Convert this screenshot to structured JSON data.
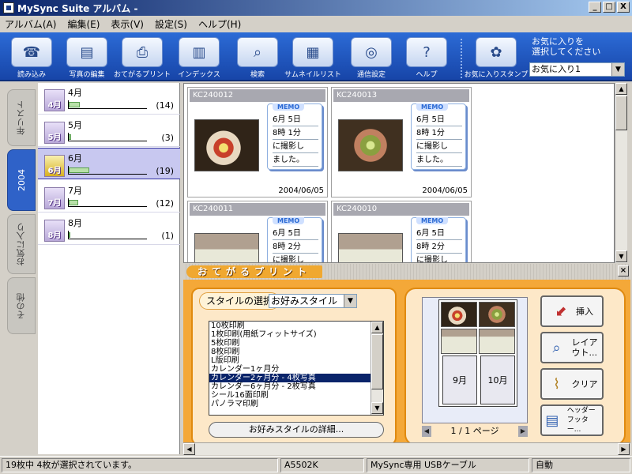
{
  "window": {
    "title": "MySync Suite アルバム -",
    "minimize": "_",
    "maximize": "□",
    "close": "X"
  },
  "menu": [
    "アルバム(A)",
    "編集(E)",
    "表示(V)",
    "設定(S)",
    "ヘルプ(H)"
  ],
  "toolbar": {
    "buttons": [
      {
        "label": "読み込み",
        "icon": "phone-icon"
      },
      {
        "label": "写真の編集",
        "icon": "photo-stack-icon"
      },
      {
        "label": "おてがるプリント",
        "icon": "print-icon"
      },
      {
        "label": "インデックス",
        "icon": "index-icon"
      },
      {
        "label": "検索",
        "icon": "search-icon"
      },
      {
        "label": "サムネイルリスト",
        "icon": "thumbnail-list-icon"
      },
      {
        "label": "通信設定",
        "icon": "headset-icon"
      },
      {
        "label": "ヘルプ",
        "icon": "help-icon"
      },
      {
        "label": "お気に入りスタンプ",
        "icon": "stamp-icon"
      }
    ],
    "favorite_caption_1": "お気に入りを",
    "favorite_caption_2": "選択してください",
    "favorite_value": "お気に入り1"
  },
  "left_tabs": [
    "年リスト",
    "2004",
    "お気に入り",
    "その他"
  ],
  "months": [
    {
      "label": "4月",
      "icon": "4月",
      "count": "(14)",
      "fill": 0.14
    },
    {
      "label": "5月",
      "icon": "5月",
      "count": "(3)",
      "fill": 0.03
    },
    {
      "label": "6月",
      "icon": "6月",
      "count": "(19)",
      "fill": 0.26
    },
    {
      "label": "7月",
      "icon": "7月",
      "count": "(12)",
      "fill": 0.12
    },
    {
      "label": "8月",
      "icon": "8月",
      "count": "(1)",
      "fill": 0.01
    }
  ],
  "photos": [
    {
      "id": "KC240012",
      "memo_tag": "MEMO",
      "memo": [
        "6月 5日",
        "8時 1分",
        "に撮影し",
        "ました。"
      ],
      "date": "2004/06/05"
    },
    {
      "id": "KC240013",
      "memo_tag": "MEMO",
      "memo": [
        "6月 5日",
        "8時 1分",
        "に撮影し",
        "ました。"
      ],
      "date": "2004/06/05"
    },
    {
      "id": "KC240011",
      "memo_tag": "MEMO",
      "memo": [
        "6月 5日",
        "8時 2分",
        "に撮影し",
        ""
      ],
      "date": ""
    },
    {
      "id": "KC240010",
      "memo_tag": "MEMO",
      "memo": [
        "6月 5日",
        "8時 2分",
        "に撮影し",
        ""
      ],
      "date": ""
    }
  ],
  "print_panel": {
    "title": "おてがるプリント",
    "style_label": "スタイルの選択",
    "style_value": "お好みスタイル",
    "styles": [
      "10枚印刷",
      "1枚印刷(用紙フィットサイズ)",
      "5枚印刷",
      "8枚印刷",
      "L版印刷",
      "カレンダー1ヶ月分",
      "カレンダー2ヶ月分 - 4枚写真",
      "カレンダー6ヶ月分 - 2枚写真",
      "シール16面印刷",
      "パノラマ印刷"
    ],
    "selected_style_index": 6,
    "detail_button": "お好みスタイルの詳細...",
    "preview_months": [
      "9月",
      "10月"
    ],
    "page_indicator": "1 / 1 ページ",
    "actions": {
      "insert": "挿入",
      "layout_1": "レイア",
      "layout_2": "ウト...",
      "clear": "クリア",
      "header_1": "ヘッダー",
      "header_2": "フッター..."
    }
  },
  "status": {
    "selection": "19枚中 4枚が選択されています。",
    "device": "A5502K",
    "connection": "MySync専用 USBケーブル",
    "mode": "自動"
  }
}
